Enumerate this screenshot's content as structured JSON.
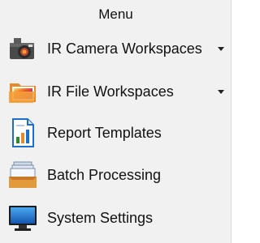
{
  "menu": {
    "title": "Menu",
    "items": [
      {
        "label": "IR Camera Workspaces",
        "icon": "ir-camera-icon",
        "has_dropdown": true
      },
      {
        "label": "IR File Workspaces",
        "icon": "ir-file-folder-icon",
        "has_dropdown": true
      },
      {
        "label": "Report Templates",
        "icon": "report-chart-icon",
        "has_dropdown": false
      },
      {
        "label": "Batch Processing",
        "icon": "batch-stack-icon",
        "has_dropdown": false
      },
      {
        "label": "System Settings",
        "icon": "monitor-icon",
        "has_dropdown": false
      }
    ]
  },
  "colors": {
    "panel_bg": "#f1f1f1",
    "text": "#111111",
    "accent_blue": "#1e6fc9",
    "accent_orange": "#e8892a"
  }
}
